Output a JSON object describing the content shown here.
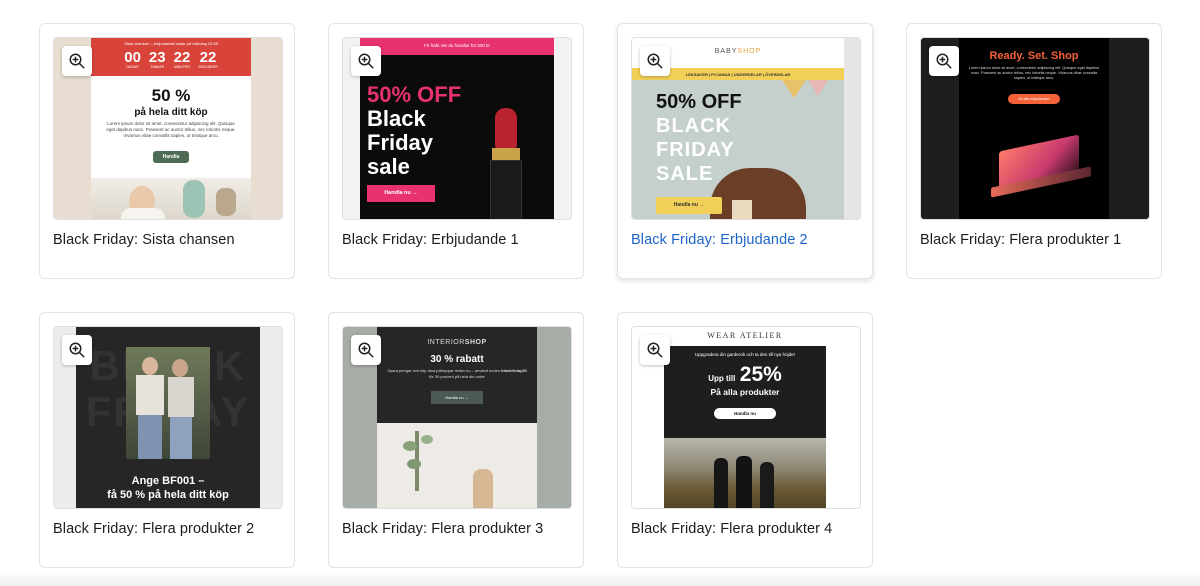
{
  "cards": [
    {
      "title": "Black Friday: Sista chansen",
      "email": {
        "topbar": "Sista chansen – erbjudandet slutar på måndag 23:59",
        "countdown": [
          {
            "value": "00",
            "label": "DAGAR"
          },
          {
            "value": "23",
            "label": "TIMMAR"
          },
          {
            "value": "22",
            "label": "MINUTER"
          },
          {
            "value": "22",
            "label": "SEKUNDER"
          }
        ],
        "headline": "50 %",
        "subhead": "på hela ditt köp",
        "body": "Lorem ipsum dolor sit amet, consectetur adipiscing elit. Quisque eget dapibus nunc. Praesent ac auctor tellus, nec lobortis neque. Vivamus vitae convallis sapien, ut tristique arcu.",
        "button": "Handla"
      }
    },
    {
      "title": "Black Friday: Erbjudande 1",
      "email": {
        "topbar": "Fri frakt när du handlar för 500 kr",
        "headline_accent": "50% OFF",
        "headline_1": "Black",
        "headline_2": "Friday",
        "headline_3": "sale",
        "button": "Handla nu →"
      }
    },
    {
      "title": "Black Friday: Erbjudande 2",
      "email": {
        "brand_1": "BABY",
        "brand_2": "SHOP",
        "nav": "LEKSAKER | PYJAMAS | UNDERDELAR | ÖVERDELAR",
        "headline_1": "50% OFF",
        "headline_2": "BLACK",
        "headline_3": "FRIDAY",
        "headline_4": "SALE",
        "button": "Handla nu →"
      }
    },
    {
      "title": "Black Friday: Flera produkter 1",
      "email": {
        "headline": "Ready. Set. Shop",
        "body": "Lorem ipsum dolor sit amet, consectetur adipiscing elit. Quisque eget dapibus nunc. Praesent ac auctor tellus, nec lobortis neque. Vivamus vitae convallis sapien, ut tristique arcu.",
        "button": "Se alla erbjudanden"
      }
    },
    {
      "title": "Black Friday: Flera produkter 2",
      "email": {
        "bg_word_1": "BLACK",
        "bg_word_2": "FRIDAY",
        "caption_1": "Ange BF001 –",
        "caption_2": "få 50 % på hela ditt köp"
      }
    },
    {
      "title": "Black Friday: Flera produkter 3",
      "email": {
        "brand_1": "INTERIOR",
        "brand_2": "SHOP",
        "headline": "30 % rabatt",
        "body_1": "Spara pengar och köp dina julklappar redan nu – använd koden",
        "code": "blackfriday30",
        "body_2": "för 30 procent på hela din order",
        "button": "Handla nu →"
      }
    },
    {
      "title": "Black Friday: Flera produkter 4",
      "email": {
        "brand": "WEAR ATELIER",
        "topline": "Uppgradera din garderob och ta den till nya höjder",
        "upto": "Upp till",
        "percent": "25%",
        "subhead": "På alla produkter",
        "button": "Handla nu"
      }
    }
  ],
  "icons": {
    "preview": "zoom-in-icon"
  },
  "colors": {
    "hover_title": "#1d64c8",
    "card_border": "#e3e3e3",
    "red": "#d9443a",
    "pink": "#e8326e",
    "yellow": "#f2cf57",
    "orange": "#f4623a"
  }
}
